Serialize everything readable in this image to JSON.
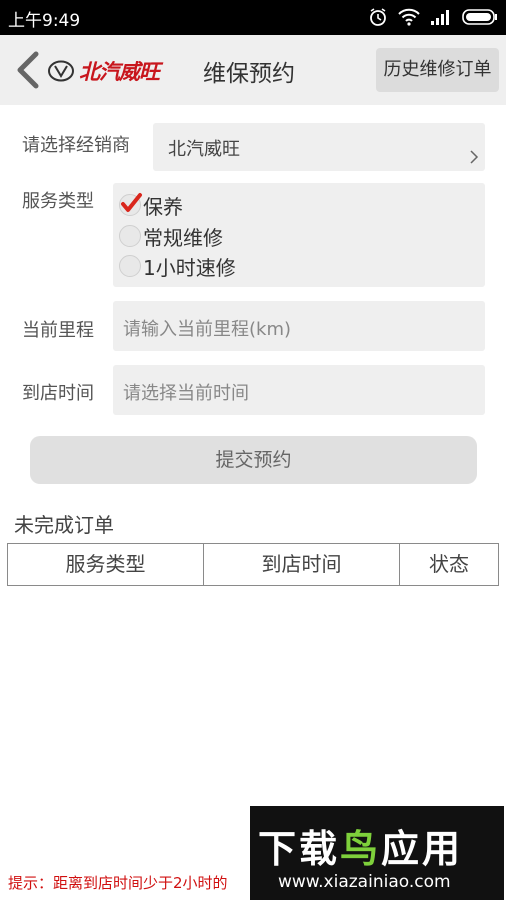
{
  "status_bar": {
    "time": "上午9:49",
    "icons": [
      "alarm-icon",
      "wifi-icon",
      "signal-icon",
      "battery-icon"
    ]
  },
  "header": {
    "brand_text": "北汽威旺",
    "title": "维保预约",
    "history_button": "历史维修订单",
    "brand_color": "#c8161d"
  },
  "form": {
    "dealer_label": "请选择经销商",
    "dealer_value": "北汽威旺",
    "service_type_label": "服务类型",
    "service_options": [
      {
        "label": "保养",
        "checked": true
      },
      {
        "label": "常规维修",
        "checked": false
      },
      {
        "label": "1小时速修",
        "checked": false
      }
    ],
    "mileage_label": "当前里程",
    "mileage_placeholder": "请输入当前里程(km)",
    "arrival_label": "到店时间",
    "arrival_placeholder": "请选择当前时间",
    "submit_button": "提交预约"
  },
  "orders": {
    "section_title": "未完成订单",
    "columns": [
      "服务类型",
      "到店时间",
      "状态"
    ]
  },
  "hint": "提示：距离到店时间少于2小时的",
  "watermark": {
    "main_text_white": "下载",
    "main_text_green": "鸟",
    "main_text_tail": "应用",
    "url": "www.xiazainiao.com"
  }
}
